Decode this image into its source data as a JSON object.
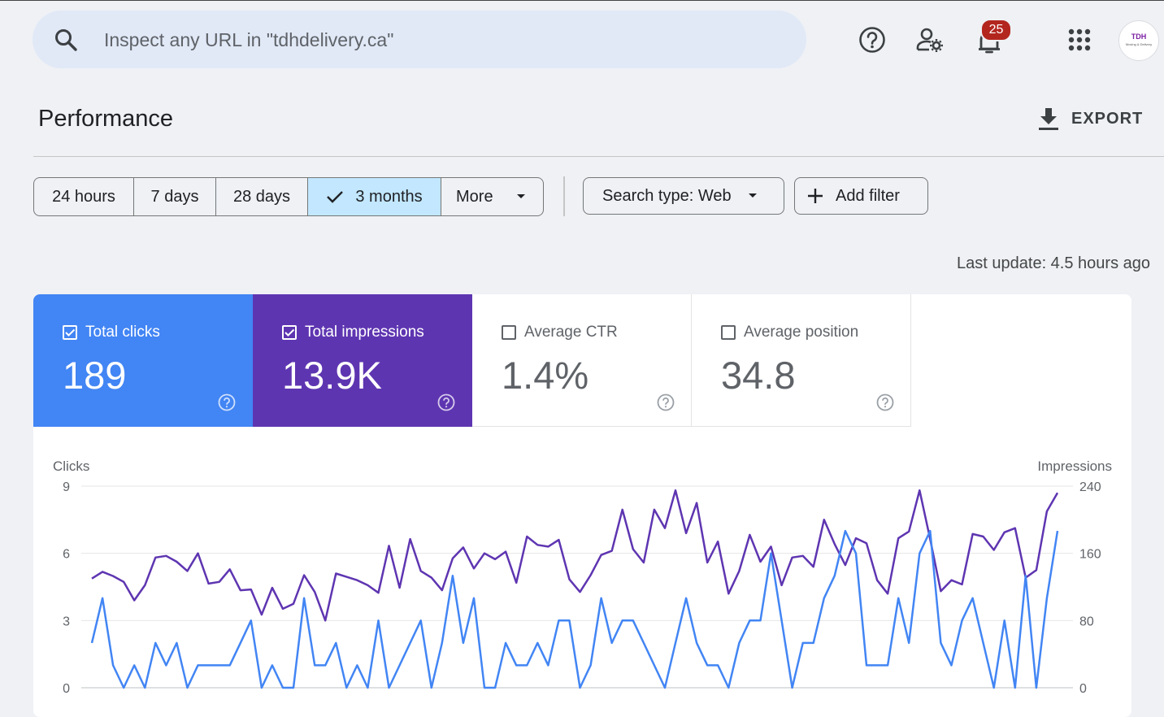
{
  "search": {
    "placeholder": "Inspect any URL in \"tdhdelivery.ca\""
  },
  "toolbar": {
    "notifications_count": "25",
    "avatar_logo": "TDH",
    "avatar_sub": "Moving & Delivery"
  },
  "page": {
    "title": "Performance",
    "export_label": "EXPORT",
    "last_update": "Last update: 4.5 hours ago"
  },
  "date_range": {
    "options": [
      "24 hours",
      "7 days",
      "28 days",
      "3 months",
      "More"
    ],
    "selected": "3 months"
  },
  "filters": {
    "search_type": "Search type: Web",
    "add_filter": "Add filter"
  },
  "metrics": [
    {
      "label": "Total clicks",
      "value": "189",
      "checked": true,
      "color": "#4285f4"
    },
    {
      "label": "Total impressions",
      "value": "13.9K",
      "checked": true,
      "color": "#5e35b1"
    },
    {
      "label": "Average CTR",
      "value": "1.4%",
      "checked": false
    },
    {
      "label": "Average position",
      "value": "34.8",
      "checked": false
    }
  ],
  "chart_data": {
    "type": "line",
    "left_axis_label": "Clicks",
    "right_axis_label": "Impressions",
    "left_ticks": [
      "9",
      "6",
      "3",
      "0"
    ],
    "right_ticks": [
      "240",
      "160",
      "80",
      "0"
    ],
    "left_range": [
      0,
      9
    ],
    "right_range": [
      0,
      240
    ],
    "grid": true,
    "series": [
      {
        "name": "Clicks",
        "axis": "left",
        "color": "#4285f4",
        "values": [
          2,
          4,
          1,
          0,
          1,
          0,
          2,
          1,
          2,
          0,
          1,
          1,
          1,
          1,
          2,
          3,
          0,
          1,
          0,
          0,
          4,
          1,
          1,
          2,
          0,
          1,
          0,
          3,
          0,
          1,
          2,
          3,
          0,
          2,
          5,
          2,
          4,
          0,
          0,
          2,
          1,
          1,
          2,
          1,
          3,
          3,
          0,
          1,
          4,
          2,
          3,
          3,
          2,
          1,
          0,
          2,
          4,
          2,
          1,
          1,
          0,
          2,
          3,
          3,
          6,
          3,
          0,
          2,
          2,
          4,
          5,
          7,
          6,
          1,
          1,
          1,
          4,
          2,
          6,
          7,
          2,
          1,
          3,
          4,
          2,
          0,
          3,
          0,
          5,
          0,
          4,
          7
        ]
      },
      {
        "name": "Impressions",
        "axis": "right",
        "color": "#5e35b1",
        "values": [
          130,
          138,
          133,
          126,
          104,
          122,
          155,
          157,
          150,
          139,
          160,
          124,
          126,
          141,
          116,
          117,
          87,
          119,
          94,
          100,
          134,
          114,
          80,
          136,
          132,
          128,
          122,
          113,
          169,
          119,
          177,
          139,
          131,
          116,
          154,
          167,
          142,
          160,
          153,
          162,
          125,
          180,
          170,
          168,
          176,
          129,
          114,
          134,
          158,
          163,
          212,
          165,
          149,
          212,
          190,
          235,
          184,
          220,
          149,
          174,
          112,
          139,
          182,
          150,
          168,
          122,
          155,
          157,
          144,
          200,
          171,
          146,
          178,
          172,
          128,
          112,
          178,
          186,
          235,
          177,
          115,
          128,
          123,
          183,
          180,
          164,
          185,
          190,
          131,
          140,
          210,
          232
        ]
      }
    ]
  }
}
